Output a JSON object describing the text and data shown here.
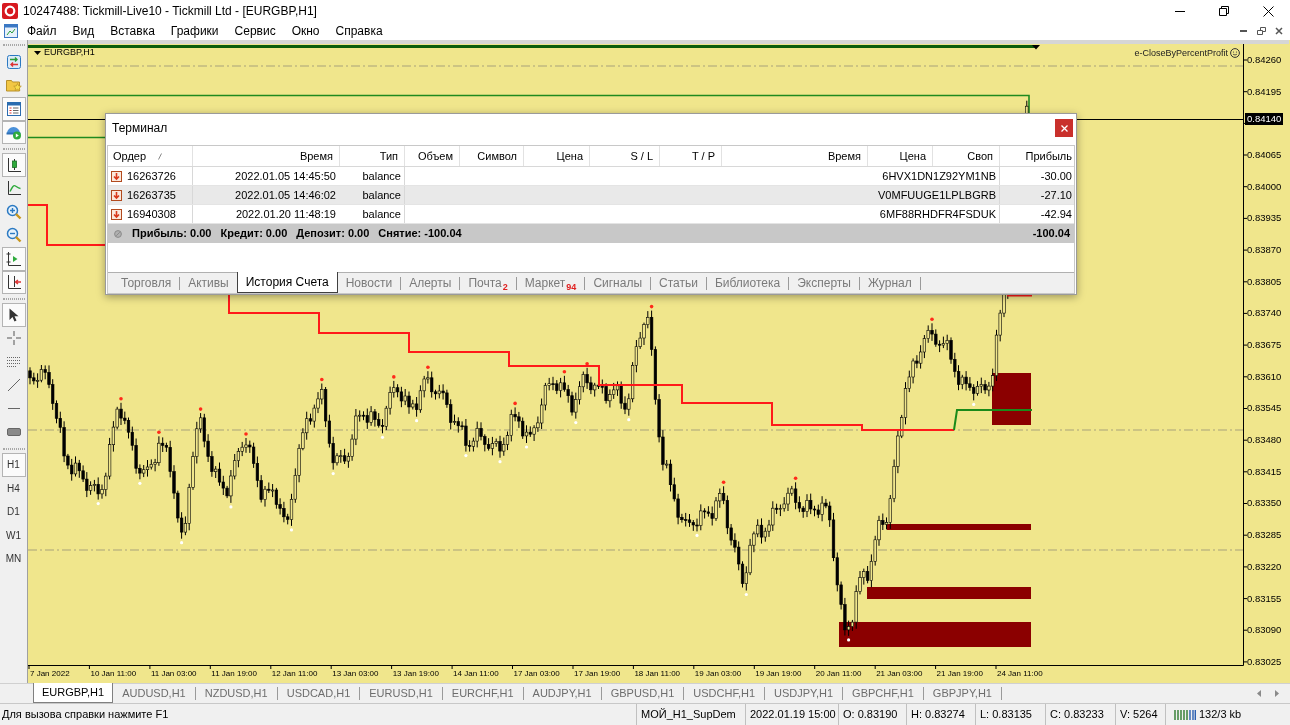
{
  "window": {
    "title": "10247488: Tickmill-Live10 - Tickmill Ltd - [EURGBP,H1]"
  },
  "menu": [
    "Файл",
    "Вид",
    "Вставка",
    "Графики",
    "Сервис",
    "Окно",
    "Справка"
  ],
  "left_toolbar": [
    {
      "pressed": false
    },
    {
      "pressed": false
    },
    {
      "pressed": true
    },
    {
      "pressed": true
    },
    {
      "pressed": true
    },
    {
      "pressed": false
    },
    {
      "pressed": false
    },
    {
      "pressed": false
    },
    {
      "pressed": true
    },
    {
      "pressed": true
    },
    {
      "pressed": true
    },
    {
      "pressed": false
    },
    {
      "pressed": false
    },
    {
      "pressed": false
    },
    {
      "pressed": false
    },
    {
      "pressed": false
    }
  ],
  "timeframes": [
    {
      "label": "H1",
      "selected": true
    },
    {
      "label": "H4",
      "selected": false
    },
    {
      "label": "D1",
      "selected": false
    },
    {
      "label": "W1",
      "selected": false
    },
    {
      "label": "MN",
      "selected": false
    }
  ],
  "chart": {
    "symbol": "EURGBP,H1",
    "expert": "e-CloseByPercentProfit",
    "price_axis": [
      {
        "label": "0.84260",
        "current": false
      },
      {
        "label": "0.84195",
        "current": false
      },
      {
        "label": "0.84140",
        "current": true
      },
      {
        "label": "0.84065",
        "current": false
      },
      {
        "label": "0.84000",
        "current": false
      },
      {
        "label": "0.83935",
        "current": false
      },
      {
        "label": "0.83870",
        "current": false
      },
      {
        "label": "0.83805",
        "current": false
      },
      {
        "label": "0.83740",
        "current": false
      },
      {
        "label": "0.83675",
        "current": false
      },
      {
        "label": "0.83610",
        "current": false
      },
      {
        "label": "0.83545",
        "current": false
      },
      {
        "label": "0.83480",
        "current": false
      },
      {
        "label": "0.83415",
        "current": false
      },
      {
        "label": "0.83350",
        "current": false
      },
      {
        "label": "0.83285",
        "current": false
      },
      {
        "label": "0.83220",
        "current": false
      },
      {
        "label": "0.83155",
        "current": false
      },
      {
        "label": "0.83090",
        "current": false
      },
      {
        "label": "0.83025",
        "current": false
      }
    ],
    "time_axis": [
      "7 Jan 2022",
      "10 Jan 11:00",
      "11 Jan 03:00",
      "11 Jan 19:00",
      "12 Jan 11:00",
      "13 Jan 03:00",
      "13 Jan 19:00",
      "14 Jan 11:00",
      "17 Jan 03:00",
      "17 Jan 19:00",
      "18 Jan 11:00",
      "19 Jan 03:00",
      "19 Jan 19:00",
      "20 Jan 11:00",
      "21 Jan 03:00",
      "21 Jan 19:00",
      "24 Jan 11:00"
    ]
  },
  "terminal": {
    "title": "Терминал",
    "columns": [
      "Ордер",
      "Время",
      "Тип",
      "Объем",
      "Символ",
      "Цена",
      "S / L",
      "T / P",
      "Время",
      "Цена",
      "Своп",
      "Прибыль"
    ],
    "rows": [
      {
        "order": "16263726",
        "time": "2022.01.05 14:45:50",
        "type": "balance",
        "comment": "6HVX1DN1Z92YM1NB",
        "profit": "-30.00"
      },
      {
        "order": "16263735",
        "time": "2022.01.05 14:46:02",
        "type": "balance",
        "comment": "V0MFUUGE1LPLBGRB",
        "profit": "-27.10"
      },
      {
        "order": "16940308",
        "time": "2022.01.20 11:48:19",
        "type": "balance",
        "comment": "6MF88RHDFR4FSDUK",
        "profit": "-42.94"
      }
    ],
    "summary": [
      "Прибыль: 0.00",
      "Кредит: 0.00",
      "Депозит: 0.00",
      "Снятие: -100.04"
    ],
    "summary_total": "-100.04",
    "tabs": [
      {
        "label": "Торговля",
        "selected": false
      },
      {
        "label": "Активы",
        "selected": false
      },
      {
        "label": "История Счета",
        "selected": true
      },
      {
        "label": "Новости",
        "selected": false
      },
      {
        "label": "Алерты",
        "selected": false
      },
      {
        "label": "Почта",
        "badge": "2",
        "selected": false
      },
      {
        "label": "Маркет",
        "badge": "94",
        "selected": false
      },
      {
        "label": "Сигналы",
        "selected": false
      },
      {
        "label": "Статьи",
        "selected": false
      },
      {
        "label": "Библиотека",
        "selected": false
      },
      {
        "label": "Эксперты",
        "selected": false
      },
      {
        "label": "Журнал",
        "selected": false
      }
    ]
  },
  "chart_tabs": [
    {
      "label": "EURGBP,H1",
      "selected": true
    },
    {
      "label": "AUDUSD,H1",
      "selected": false
    },
    {
      "label": "NZDUSD,H1",
      "selected": false
    },
    {
      "label": "USDCAD,H1",
      "selected": false
    },
    {
      "label": "EURUSD,H1",
      "selected": false
    },
    {
      "label": "EURCHF,H1",
      "selected": false
    },
    {
      "label": "AUDJPY,H1",
      "selected": false
    },
    {
      "label": "GBPUSD,H1",
      "selected": false
    },
    {
      "label": "USDCHF,H1",
      "selected": false
    },
    {
      "label": "USDJPY,H1",
      "selected": false
    },
    {
      "label": "GBPCHF,H1",
      "selected": false
    },
    {
      "label": "GBPJPY,H1",
      "selected": false
    }
  ],
  "status_bar": {
    "help": "Для вызова справки нажмите F1",
    "template": "МОЙ_H1_SupDem",
    "bar_time": "2022.01.19 15:00",
    "open": "O: 0.83190",
    "high": "H: 0.83274",
    "low": "L: 0.83135",
    "close": "C: 0.83233",
    "volume": "V: 5264",
    "traffic": "132/3 kb"
  }
}
